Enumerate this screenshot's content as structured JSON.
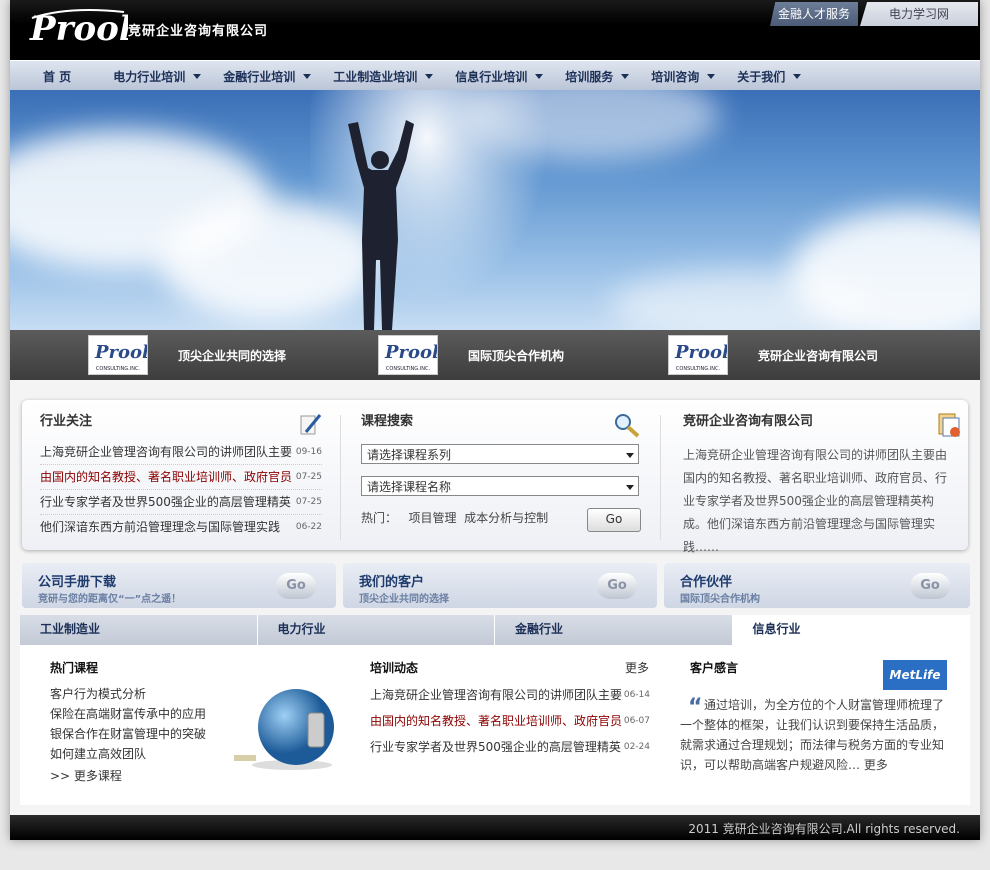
{
  "header": {
    "logo_text": "Prool",
    "company": "竞研企业咨询有限公司",
    "top_tabs": [
      "金融人才服务",
      "电力学习网"
    ]
  },
  "nav": [
    {
      "label": "首 页",
      "dropdown": false
    },
    {
      "label": "电力行业培训",
      "dropdown": true
    },
    {
      "label": "金融行业培训",
      "dropdown": true
    },
    {
      "label": "工业制造业培训",
      "dropdown": true
    },
    {
      "label": "信息行业培训",
      "dropdown": true
    },
    {
      "label": "培训服务",
      "dropdown": true
    },
    {
      "label": "培训咨询",
      "dropdown": true
    },
    {
      "label": "关于我们",
      "dropdown": true
    }
  ],
  "strip": [
    {
      "logo": "CONSULTING.INC.",
      "text": "顶尖企业共同的选择"
    },
    {
      "logo": "CONSULTING.INC.",
      "text": "国际顶尖合作机构"
    },
    {
      "logo": "CONSULTING.INC.",
      "text": "竞研企业咨询有限公司"
    }
  ],
  "industry": {
    "title": "行业关注",
    "items": [
      {
        "text": "上海竞研企业管理咨询有限公司的讲师团队主要",
        "date": "09-16",
        "highlight": false
      },
      {
        "text": "由国内的知名教授、著名职业培训师、政府官员",
        "date": "07-25",
        "highlight": true
      },
      {
        "text": "行业专家学者及世界500强企业的高层管理精英",
        "date": "07-25",
        "highlight": false
      },
      {
        "text": "他们深谙东西方前沿管理理念与国际管理实践",
        "date": "06-22",
        "highlight": false
      }
    ]
  },
  "search": {
    "title": "课程搜索",
    "select1": "请选择课程系列",
    "select2": "请选择课程名称",
    "hot_label": "热门：",
    "hot1": "项目管理",
    "hot2": "成本分析与控制",
    "go": "Go"
  },
  "company_box": {
    "title": "竞研企业咨询有限公司",
    "text": "上海竞研企业管理咨询有限公司的讲师团队主要由国内的知名教授、著名职业培训师、政府官员、行业专家学者及世界500强企业的高层管理精英构成。他们深谙东西方前沿管理理念与国际管理实践……"
  },
  "quick": [
    {
      "title": "公司手册下载",
      "sub": "竞研与您的距离仅“一”点之遥！",
      "go": "Go"
    },
    {
      "title": "我们的客户",
      "sub": "顶尖企业共同的选择",
      "go": "Go"
    },
    {
      "title": "合作伙伴",
      "sub": "国际顶尖合作机构",
      "go": "Go"
    }
  ],
  "tabs": [
    "工业制造业",
    "电力行业",
    "金融行业",
    "信息行业"
  ],
  "hot_courses": {
    "title": "热门课程",
    "items": [
      "客户行为模式分析",
      "保险在高端财富传承中的应用",
      "银保合作在财富管理中的突破",
      "如何建立高效团队"
    ],
    "more": ">> 更多课程"
  },
  "training_news": {
    "title": "培训动态",
    "more": "更多",
    "items": [
      {
        "text": "上海竞研企业管理咨询有限公司的讲师团队主要",
        "date": "06-14",
        "highlight": false
      },
      {
        "text": "由国内的知名教授、著名职业培训师、政府官员",
        "date": "06-07",
        "highlight": true
      },
      {
        "text": "行业专家学者及世界500强企业的高层管理精英",
        "date": "02-24",
        "highlight": false
      }
    ]
  },
  "testimonial": {
    "title": "客户感言",
    "brand": "MetLife",
    "text": "通过培训，为全方位的个人财富管理师梳理了一个整体的框架，让我们认识到要保持生活品质，就需求通过合理规划；而法律与税务方面的专业知识，可以帮助高端客户规避风险… 更多"
  },
  "footer": "2011 竞研企业咨询有限公司.All rights reserved."
}
